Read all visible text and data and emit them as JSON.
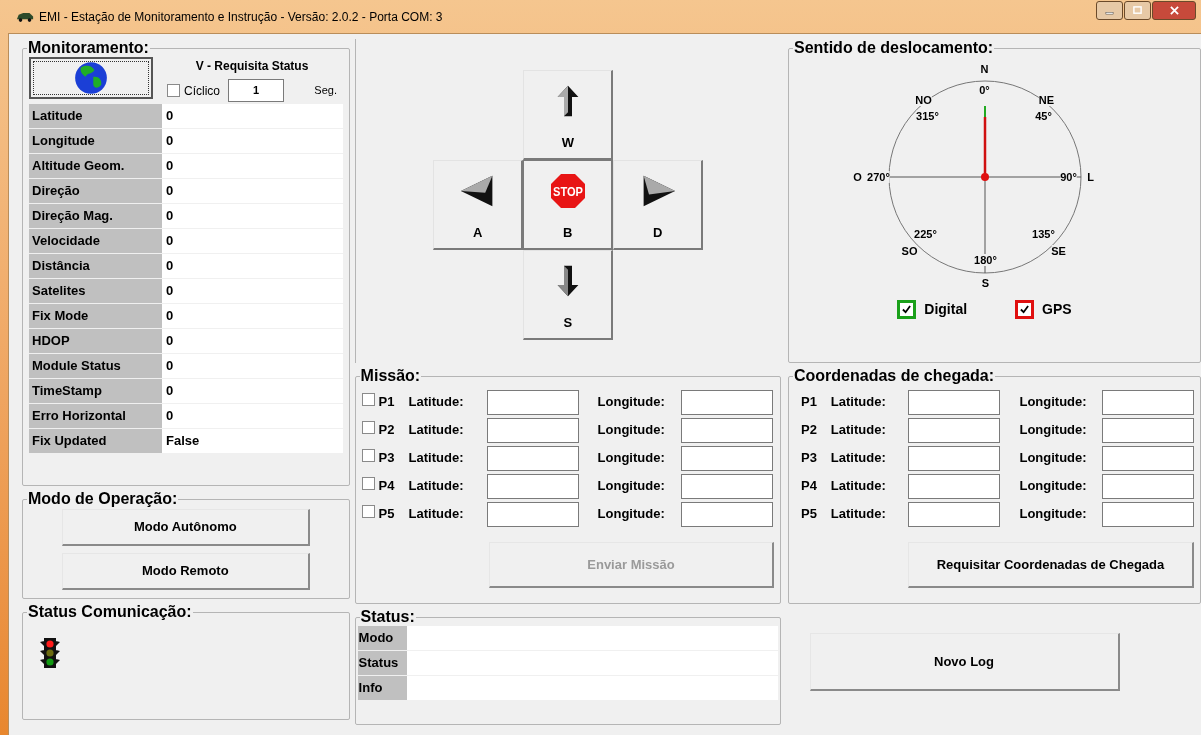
{
  "window": {
    "title": "EMI - Estação de Monitoramento e Instrução - Versão: 2.0.2 - Porta COM: 3"
  },
  "monitoramento": {
    "title": "Monitoramento:",
    "request_label": "V - Requisita Status",
    "cyclic": {
      "label": "Cíclico",
      "checked": false
    },
    "interval": "1",
    "interval_unit": "Seg.",
    "fields": [
      {
        "label": "Latitude",
        "value": "0"
      },
      {
        "label": "Longitude",
        "value": "0"
      },
      {
        "label": "Altitude Geom.",
        "value": "0"
      },
      {
        "label": "Direção",
        "value": "0"
      },
      {
        "label": "Direção Mag.",
        "value": "0"
      },
      {
        "label": "Velocidade",
        "value": "0"
      },
      {
        "label": "Distância",
        "value": "0"
      },
      {
        "label": "Satelites",
        "value": "0"
      },
      {
        "label": "Fix Mode",
        "value": "0"
      },
      {
        "label": "HDOP",
        "value": "0"
      },
      {
        "label": "Module Status",
        "value": "0"
      },
      {
        "label": "TimeStamp",
        "value": "0"
      },
      {
        "label": "Erro Horizontal",
        "value": "0"
      },
      {
        "label": "Fix Updated",
        "value": "False"
      }
    ]
  },
  "modo_operacao": {
    "title": "Modo de Operação:",
    "buttons": [
      "Modo Autônomo",
      "Modo Remoto"
    ]
  },
  "status_comunicacao": {
    "title": "Status Comunicação:"
  },
  "direction_pad": [
    {
      "key": "W",
      "kind": "up"
    },
    {
      "key": "A",
      "kind": "left"
    },
    {
      "key": "B",
      "kind": "stop",
      "sign": "STOP"
    },
    {
      "key": "D",
      "kind": "right"
    },
    {
      "key": "S",
      "kind": "down"
    }
  ],
  "missao": {
    "title": "Missão:",
    "points": [
      {
        "label": "P1",
        "checked": false,
        "latitude_label": "Latitude:",
        "longitude_label": "Longitude:"
      },
      {
        "label": "P2",
        "checked": false,
        "latitude_label": "Latitude:",
        "longitude_label": "Longitude:"
      },
      {
        "label": "P3",
        "checked": false,
        "latitude_label": "Latitude:",
        "longitude_label": "Longitude:"
      },
      {
        "label": "P4",
        "checked": false,
        "latitude_label": "Latitude:",
        "longitude_label": "Longitude:"
      },
      {
        "label": "P5",
        "checked": false,
        "latitude_label": "Latitude:",
        "longitude_label": "Longitude:"
      }
    ],
    "send_button": {
      "label": "Enviar Missão",
      "disabled": true
    }
  },
  "status": {
    "title": "Status:",
    "rows": [
      {
        "label": "Modo"
      },
      {
        "label": "Status"
      },
      {
        "label": "Info"
      }
    ]
  },
  "sentido": {
    "title": "Sentido de deslocamento:",
    "compass_labels": [
      "N",
      "NO",
      "NE",
      "0°",
      "315°",
      "45°",
      "O",
      "270°",
      "90°",
      "L",
      "225°",
      "135°",
      "SO",
      "SE",
      "180°",
      "S"
    ],
    "options": [
      {
        "label": "Digital",
        "checked": true,
        "color": "#1aa01a"
      },
      {
        "label": "GPS",
        "checked": true,
        "color": "#e01010"
      }
    ]
  },
  "coordenadas": {
    "title": "Coordenadas de chegada:",
    "points": [
      {
        "label": "P1",
        "latitude_label": "Latitude:",
        "longitude_label": "Longitude:"
      },
      {
        "label": "P2",
        "latitude_label": "Latitude:",
        "longitude_label": "Longitude:"
      },
      {
        "label": "P3",
        "latitude_label": "Latitude:",
        "longitude_label": "Longitude:"
      },
      {
        "label": "P4",
        "latitude_label": "Latitude:",
        "longitude_label": "Longitude:"
      },
      {
        "label": "P5",
        "latitude_label": "Latitude:",
        "longitude_label": "Longitude:"
      }
    ],
    "button": "Requisitar Coordenadas de Chegada"
  },
  "log_button": "Novo Log"
}
